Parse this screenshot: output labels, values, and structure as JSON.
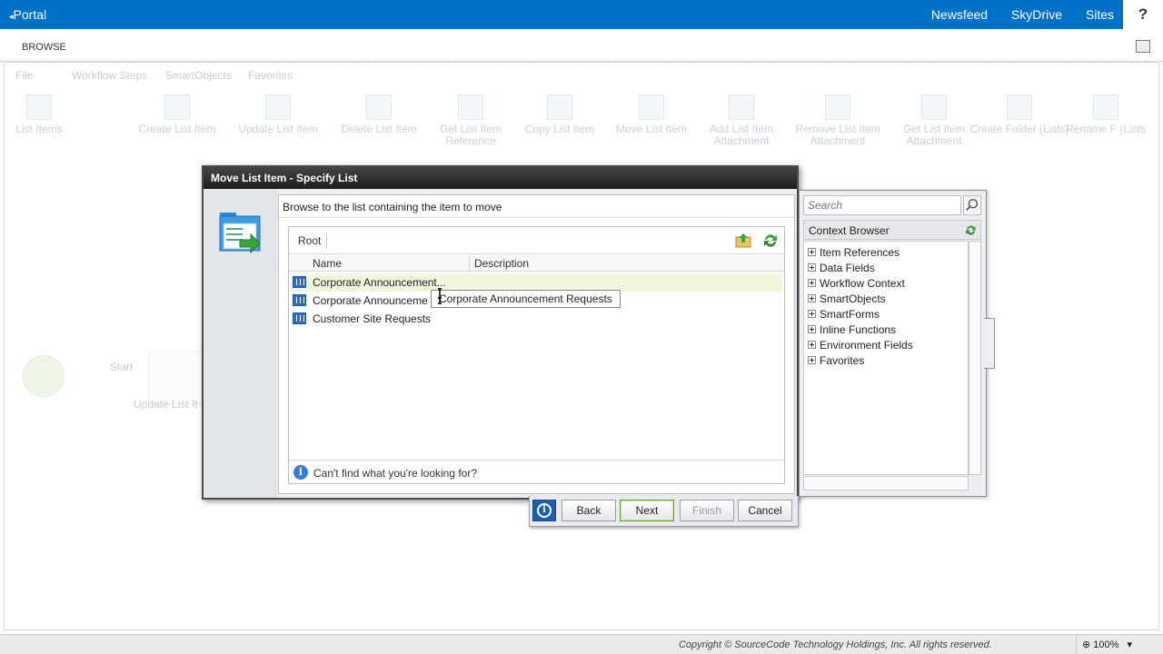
{
  "suite_bar": {
    "portal_label": "Portal",
    "links": [
      "Newsfeed",
      "SkyDrive",
      "Sites"
    ],
    "help_label": "?"
  },
  "ribbon": {
    "tab_label": "BROWSE",
    "faded_tabs": [
      "File",
      "Workflow Steps",
      "SmartObjects",
      "Favorites"
    ],
    "faded_group_label": "List Items",
    "faded_tools": [
      "Create List Item",
      "Update List Item",
      "Delete List Item",
      "Get List Item Reference",
      "Copy List Item",
      "Move List Item",
      "Add List Item Attachment",
      "Remove List Item Attachment",
      "Get List Item Attachment",
      "Create Folder (Lists)",
      "Rename F (Lists"
    ]
  },
  "canvas": {
    "start_label": "Start",
    "step_label": "Update List It"
  },
  "dialog": {
    "title": "Move List Item - Specify List",
    "instruction": "Browse to the list containing the item to move",
    "breadcrumb": "Root",
    "columns": [
      "Name",
      "Description"
    ],
    "rows": [
      {
        "name": "Corporate Announcement...",
        "selected": true
      },
      {
        "name": "Corporate Announceme",
        "selected": false
      },
      {
        "name": "Customer Site Requests",
        "selected": false
      }
    ],
    "tooltip": "Corporate Announcement Requests",
    "help_text": "Can't find what you're looking for?",
    "buttons": {
      "back": "Back",
      "next": "Next",
      "finish": "Finish",
      "cancel": "Cancel"
    }
  },
  "context_browser": {
    "search_placeholder": "Search",
    "title": "Context Browser",
    "items": [
      "Item References",
      "Data Fields",
      "Workflow Context",
      "SmartObjects",
      "SmartForms",
      "Inline Functions",
      "Environment Fields",
      "Favorites"
    ]
  },
  "status_bar": {
    "copyright": "Copyright © SourceCode Technology Holdings, Inc. All rights reserved.",
    "zoom": "100%"
  },
  "colors": {
    "suite_blue": "#0072c6",
    "dialog_title_bg": "#2b2b2b",
    "selected_row": "#f1f6dd",
    "accent_green": "#6f9a3b"
  }
}
